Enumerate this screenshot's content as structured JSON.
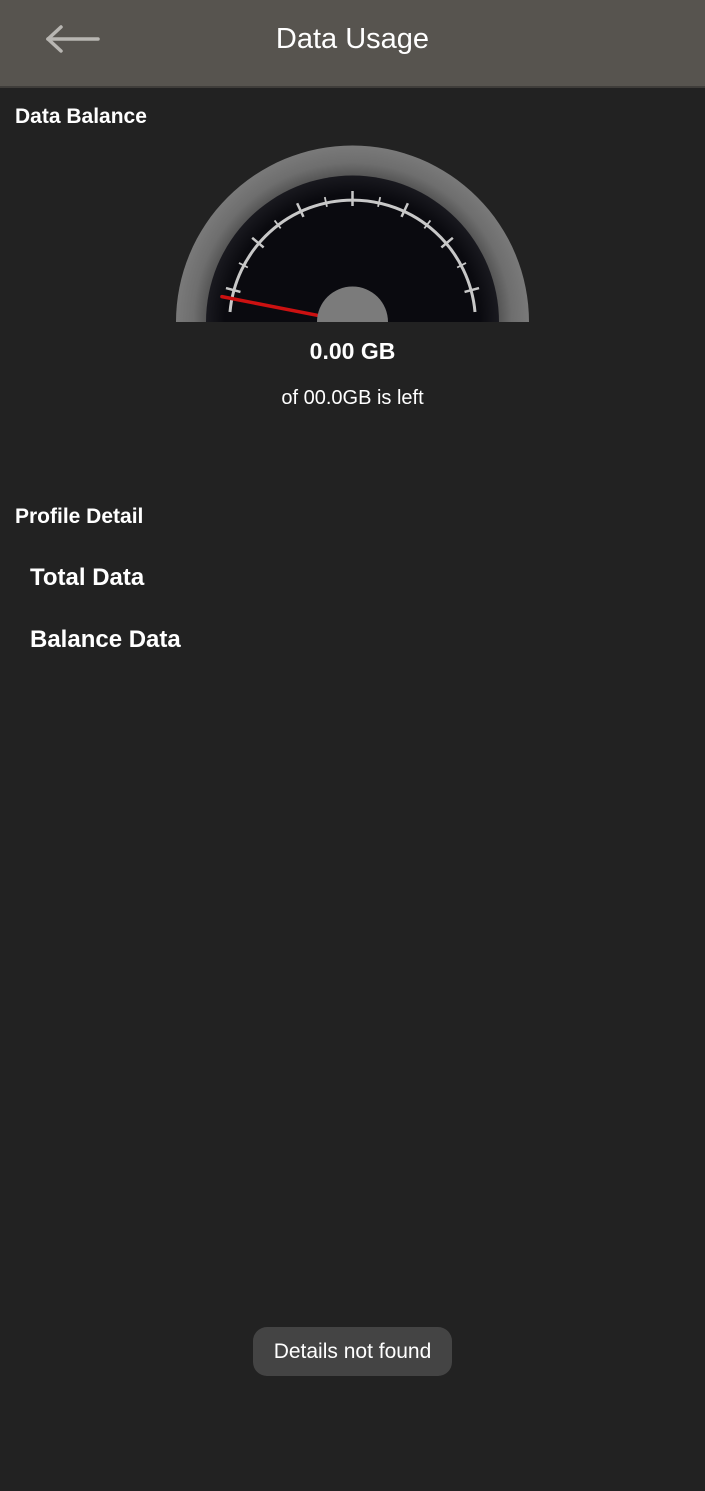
{
  "app_bar": {
    "title": "Data Usage",
    "back_icon": "arrow-left-icon"
  },
  "data_balance": {
    "section_label": "Data Balance",
    "gauge": {
      "value_label": "0.00 GB",
      "subtitle": "of 00.0GB is left",
      "needle_level": 0.0,
      "needle_color": "#cc1111"
    }
  },
  "profile_detail": {
    "section_label": "Profile Detail",
    "rows": [
      {
        "label": "Total Data"
      },
      {
        "label": "Balance Data"
      }
    ]
  },
  "toast": {
    "message": "Details not found"
  }
}
